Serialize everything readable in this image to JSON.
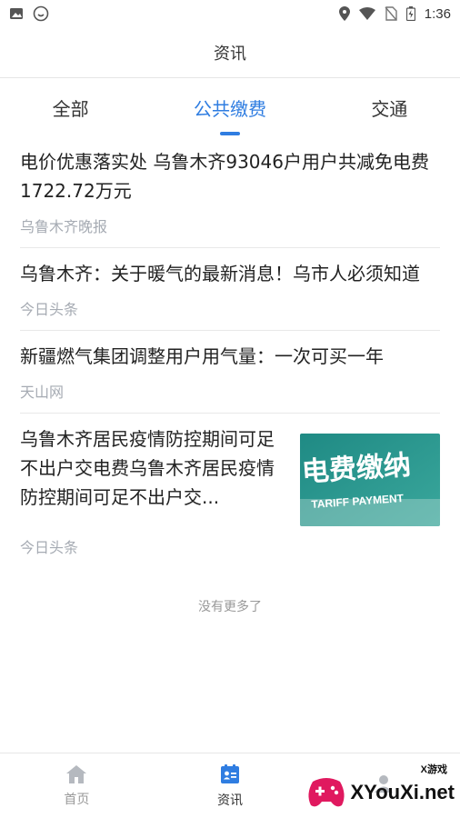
{
  "status_bar": {
    "time": "1:36",
    "left_icons": [
      "image-icon",
      "clock-circle-icon"
    ],
    "right_icons": [
      "location-icon",
      "wifi-icon",
      "no-sim-icon",
      "battery-icon"
    ]
  },
  "header": {
    "title": "资讯"
  },
  "tabs": [
    {
      "label": "全部",
      "active": false
    },
    {
      "label": "公共缴费",
      "active": true
    },
    {
      "label": "交通",
      "active": false
    }
  ],
  "news": [
    {
      "title": "电价优惠落实处 乌鲁木齐93046户用户共减免电费1722.72万元",
      "source": "乌鲁木齐晚报"
    },
    {
      "title": "乌鲁木齐：关于暖气的最新消息！乌市人必须知道",
      "source": "今日头条"
    },
    {
      "title": "新疆燃气集团调整用户用气量：一次可买一年",
      "source": "天山网"
    },
    {
      "title": "乌鲁木齐居民疫情防控期间可足不出户交电费乌鲁木齐居民疫情防控期间可足不出户交...",
      "source": "今日头条",
      "thumb_text": "电费缴纳",
      "thumb_sub": "TARIFF PAYMENT"
    }
  ],
  "footer_text": "没有更多了",
  "bottom_nav": [
    {
      "label": "首页",
      "icon": "home-icon",
      "active": false
    },
    {
      "label": "资讯",
      "icon": "news-icon",
      "active": true
    },
    {
      "label": "",
      "icon": "profile-icon",
      "active": false
    }
  ],
  "watermark": {
    "text": "XYouXi.net",
    "small": "X游戏"
  },
  "colors": {
    "accent": "#2f7de1",
    "source_gray": "#a6abb3"
  }
}
